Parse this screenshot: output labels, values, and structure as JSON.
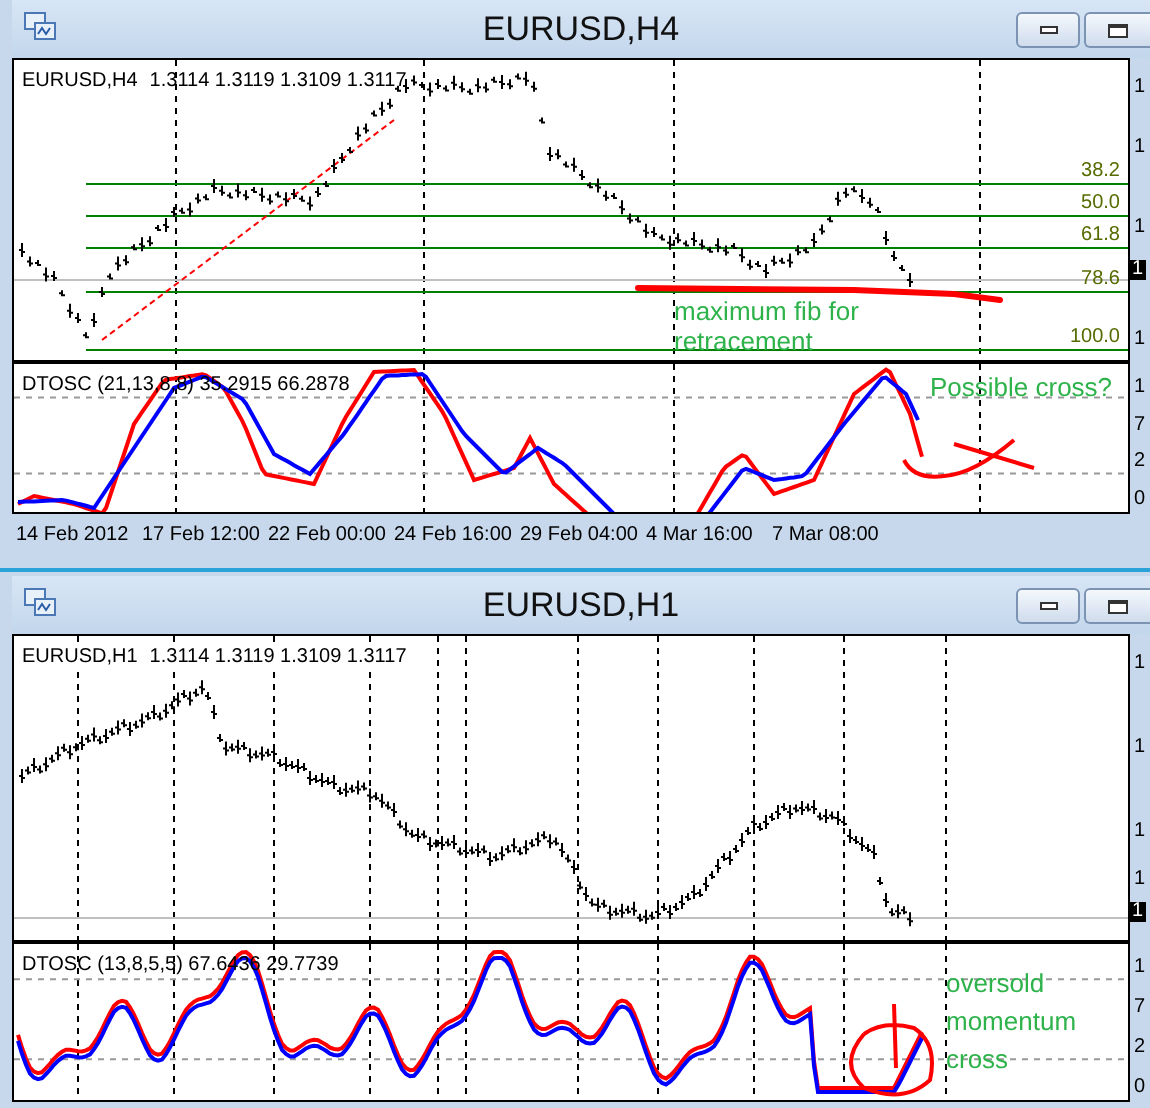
{
  "windows": [
    {
      "title": "EURUSD,H4",
      "legend": {
        "symbol": "EURUSD,H4",
        "prices": "1.3114 1.3119 1.3109 1.3117"
      },
      "fib_levels": [
        "38.2",
        "50.0",
        "61.8",
        "78.6",
        "100.0"
      ],
      "price_axis": [
        "1",
        "1",
        "1",
        "1"
      ],
      "current_price": "1",
      "note": "maximum fib for retracement",
      "oscillator": {
        "legend": "DTOSC (21,13,8,8) 35.2915 66.2878",
        "axis": [
          "1",
          "7",
          "2",
          "0"
        ],
        "note": "Possible cross?"
      },
      "time_axis": [
        "14 Feb 2012",
        "17 Feb 12:00",
        "22 Feb 00:00",
        "24 Feb 16:00",
        "29 Feb 04:00",
        "4 Mar 16:00",
        "7 Mar 08:00"
      ]
    },
    {
      "title": "EURUSD,H1",
      "legend": {
        "symbol": "EURUSD,H1",
        "prices": "1.3114 1.3119 1.3109 1.3117"
      },
      "price_axis": [
        "1",
        "1",
        "1",
        "1"
      ],
      "current_price": "1",
      "oscillator": {
        "legend": "DTOSC (13,8,5,5) 67.6436 29.7739",
        "axis": [
          "1",
          "7",
          "2",
          "0"
        ],
        "note": "oversold momentum cross"
      }
    }
  ]
}
